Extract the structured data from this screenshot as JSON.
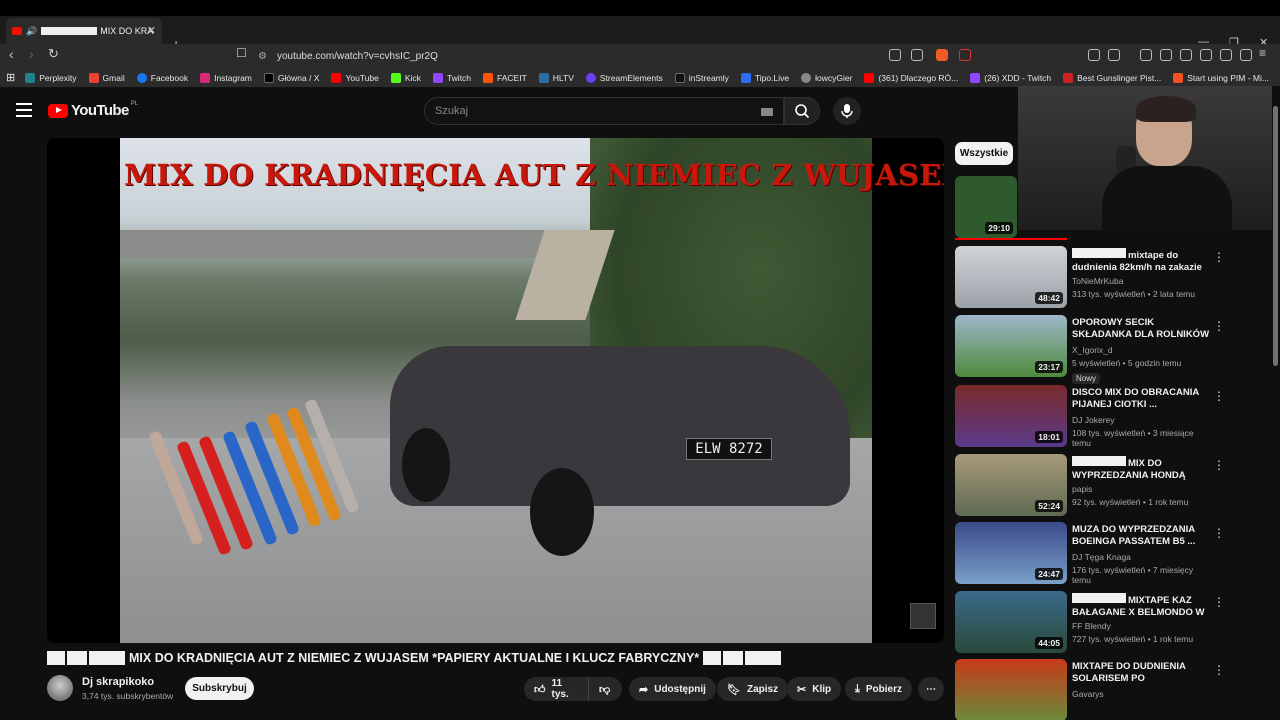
{
  "browser": {
    "tab_title": "MIX DO KRA",
    "new_tab": "+",
    "url": "youtube.com/watch?v=cvhsIC_pr2Q",
    "bookmarks": [
      {
        "label": "Perplexity",
        "color": "#20808d"
      },
      {
        "label": "Gmail",
        "color": "#ea4335"
      },
      {
        "label": "Facebook",
        "color": "#1877f2"
      },
      {
        "label": "Instagram",
        "color": "#d62976"
      },
      {
        "label": "Główna / X",
        "color": "#000000"
      },
      {
        "label": "YouTube",
        "color": "#ff0000"
      },
      {
        "label": "Kick",
        "color": "#53fc18"
      },
      {
        "label": "Twitch",
        "color": "#9146ff"
      },
      {
        "label": "FACEIT",
        "color": "#ff5500"
      },
      {
        "label": "HLTV",
        "color": "#2d6da3"
      },
      {
        "label": "StreamElements",
        "color": "#6c3ef4"
      },
      {
        "label": "inStreamly",
        "color": "#111111"
      },
      {
        "label": "Tipo.Live",
        "color": "#2b6cf0"
      },
      {
        "label": "łowcyGier",
        "color": "#888888"
      },
      {
        "label": "(361) Dlaczego RÓ...",
        "color": "#ff0000"
      },
      {
        "label": "(26) XDD - Twitch",
        "color": "#9146ff"
      },
      {
        "label": "Best Gunslinger Pist...",
        "color": "#cc2222"
      },
      {
        "label": "Start using PIM - Mi...",
        "color": "#f25022"
      }
    ]
  },
  "header": {
    "logo": "YouTube",
    "region": "PL",
    "search_placeholder": "Szukaj"
  },
  "video": {
    "overlay_text": "MIX DO KRADNIĘCIA AUT Z NIEMIEC Z WUJASEM",
    "plate": "ELW 8272",
    "title": "MIX DO KRADNIĘCIA AUT Z NIEMIEC Z WUJASEM *PAPIERY AKTUALNE I KLUCZ FABRYCZNY*",
    "channel": "Dj skrapikoko",
    "subscribers": "3,74 tys. subskrybentów",
    "subscribe_label": "Subskrybuj",
    "likes": "11 tys.",
    "share_label": "Udostępnij",
    "save_label": "Zapisz",
    "clip_label": "Klip",
    "download_label": "Pobierz"
  },
  "sidebar": {
    "chip": "Wszystkie",
    "items": [
      {
        "title": "",
        "channel": "",
        "stats": "",
        "duration": "29:10",
        "thumb": "#2f5a2e"
      },
      {
        "title": "mixtape do dudnienia 82km/h na zakazie ...",
        "channel": "ToNieMrKuba",
        "stats": "313 tys. wyświetleń • 2 lata temu",
        "duration": "48:42",
        "thumb": "#c8ccd2"
      },
      {
        "title": "OPOROWY SECIK SKŁADANKA DLA ROLNIKÓW ...",
        "channel": "X_Igorix_d",
        "stats": "5 wyświetleń • 5 godzin temu",
        "badge": "Nowy",
        "duration": "23:17",
        "thumb": "#4d8a3c"
      },
      {
        "title": "DISCO MIX DO OBRACANIA PIJANEJ CIOTKI ...",
        "channel": "DJ Jokerey",
        "stats": "108 tys. wyświetleń • 3 miesiące temu",
        "duration": "18:01",
        "thumb": "#5a3a8a"
      },
      {
        "title": "MIX DO WYPRZEDZANIA HONDĄ CIVI...",
        "channel": "papis",
        "stats": "92 tys. wyświetleń • 1 rok temu",
        "duration": "52:24",
        "thumb": "#8a7a5a"
      },
      {
        "title": "MUZA DO WYPRZEDZANIA BOEINGA PASSATEM B5 ...",
        "channel": "DJ Tęga Knaga",
        "stats": "176 tys. wyświetleń • 7 miesięcy temu",
        "duration": "24:47",
        "thumb": "#5a7aa8"
      },
      {
        "title": "MIXTAPE KAZ BAŁAGANE X BELMONDO W ...",
        "channel": "FF Blendy",
        "stats": "727 tys. wyświetleń • 1 rok temu",
        "duration": "44:05",
        "thumb": "#3a6a8a"
      },
      {
        "title": "MIXTAPE DO DUDNIENIA SOLARISEM PO CHRZANOWIE...",
        "channel": "Gavarys",
        "stats": "",
        "duration": "",
        "thumb": "#6a8a3a"
      }
    ]
  }
}
